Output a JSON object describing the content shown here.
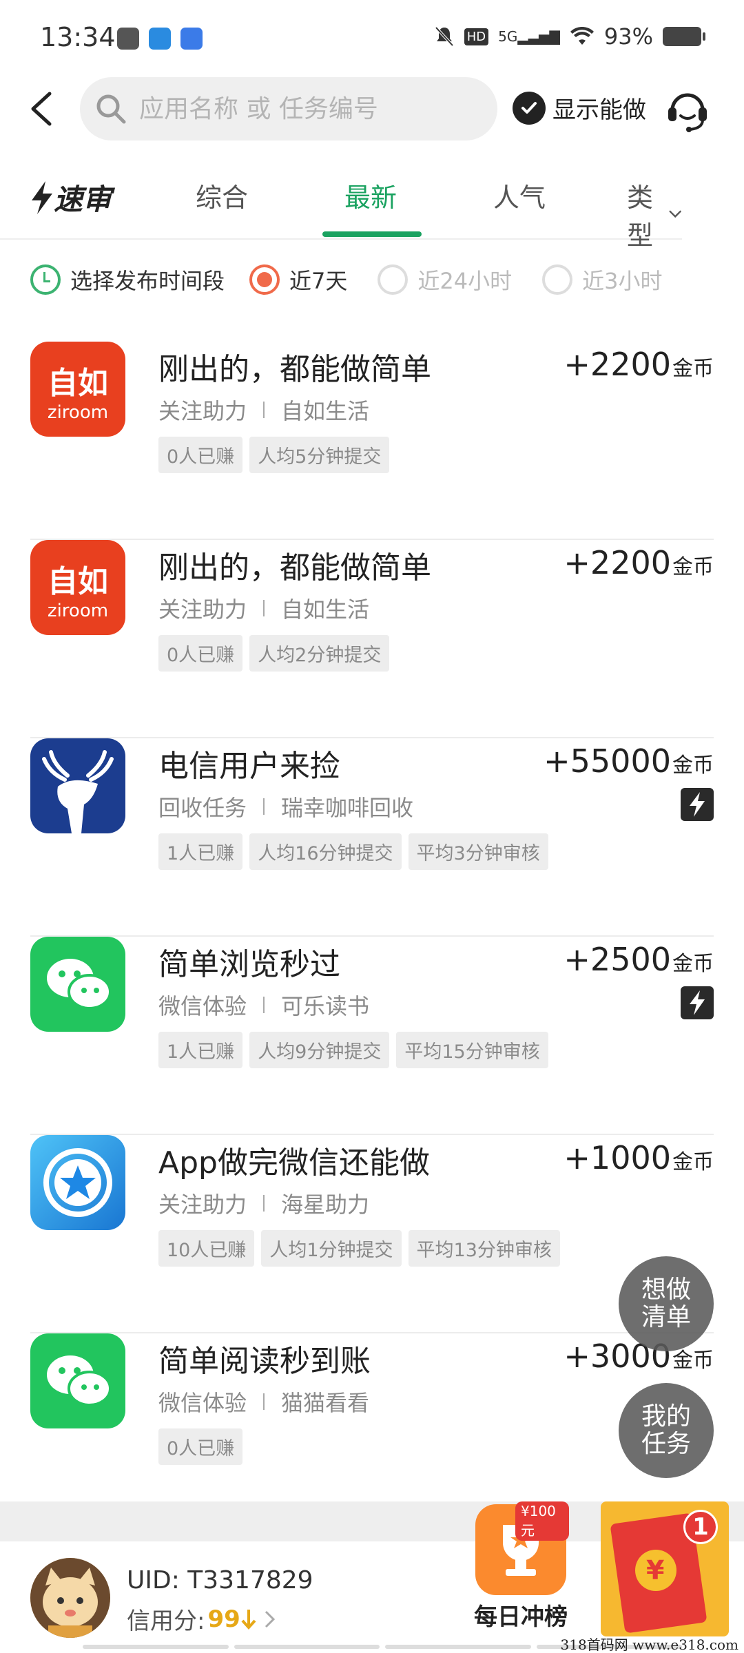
{
  "status_bar": {
    "time": "13:34",
    "signal": "5G",
    "hd": "HD",
    "battery": "93%"
  },
  "search": {
    "placeholder": "应用名称 或 任务编号"
  },
  "header": {
    "show_can_do": "显示能做"
  },
  "tabs": {
    "logo": "速审",
    "items": [
      {
        "label": "综合"
      },
      {
        "label": "最新"
      },
      {
        "label": "人气"
      },
      {
        "label": "类型"
      }
    ],
    "active_index": 1
  },
  "filter": {
    "label": "选择发布时间段",
    "options": [
      "近7天",
      "近24小时",
      "近3小时"
    ],
    "selected": "近7天"
  },
  "tasks": [
    {
      "title": "刚出的，都能做简单",
      "category": "关注助力",
      "app": "自如生活",
      "tags": [
        "0人已赚",
        "人均5分钟提交"
      ],
      "reward": "+2200",
      "unit": "金币",
      "icon": "ziroom-icon",
      "icon_text": [
        "自如",
        "ziroom"
      ],
      "fast": false
    },
    {
      "title": "刚出的，都能做简单",
      "category": "关注助力",
      "app": "自如生活",
      "tags": [
        "0人已赚",
        "人均2分钟提交"
      ],
      "reward": "+2200",
      "unit": "金币",
      "icon": "ziroom-icon",
      "icon_text": [
        "自如",
        "ziroom"
      ],
      "fast": false
    },
    {
      "title": "电信用户来捡",
      "category": "回收任务",
      "app": "瑞幸咖啡回收",
      "tags": [
        "1人已赚",
        "人均16分钟提交",
        "平均3分钟审核"
      ],
      "reward": "+55000",
      "unit": "金币",
      "icon": "luckin-deer-icon",
      "fast": true
    },
    {
      "title": "简单浏览秒过",
      "category": "微信体验",
      "app": "可乐读书",
      "tags": [
        "1人已赚",
        "人均9分钟提交",
        "平均15分钟审核"
      ],
      "reward": "+2500",
      "unit": "金币",
      "icon": "wechat-icon",
      "fast": true
    },
    {
      "title": "App做完微信还能做",
      "category": "关注助力",
      "app": "海星助力",
      "tags": [
        "10人已赚",
        "人均1分钟提交",
        "平均13分钟审核"
      ],
      "reward": "+1000",
      "unit": "金币",
      "icon": "starfish-icon",
      "fast": false
    },
    {
      "title": "简单阅读秒到账",
      "category": "微信体验",
      "app": "猫猫看看",
      "tags": [
        "0人已赚"
      ],
      "reward": "+3000",
      "unit": "金币",
      "icon": "wechat-icon",
      "fast": false
    }
  ],
  "fabs": {
    "wishlist": "想做清单",
    "my_tasks": "我的任务"
  },
  "user": {
    "uid": "UID: T3317829",
    "credit_label": "信用分:",
    "credit_value": "99"
  },
  "daily": {
    "label": "每日冲榜",
    "badge": "¥100元"
  },
  "redpack": {
    "count": "1",
    "symbol": "¥"
  },
  "watermark": "318首码网  www.e318.com",
  "colors": {
    "accent": "#1aa260",
    "radio_on": "#f06a4a",
    "credit": "#e6a817"
  }
}
